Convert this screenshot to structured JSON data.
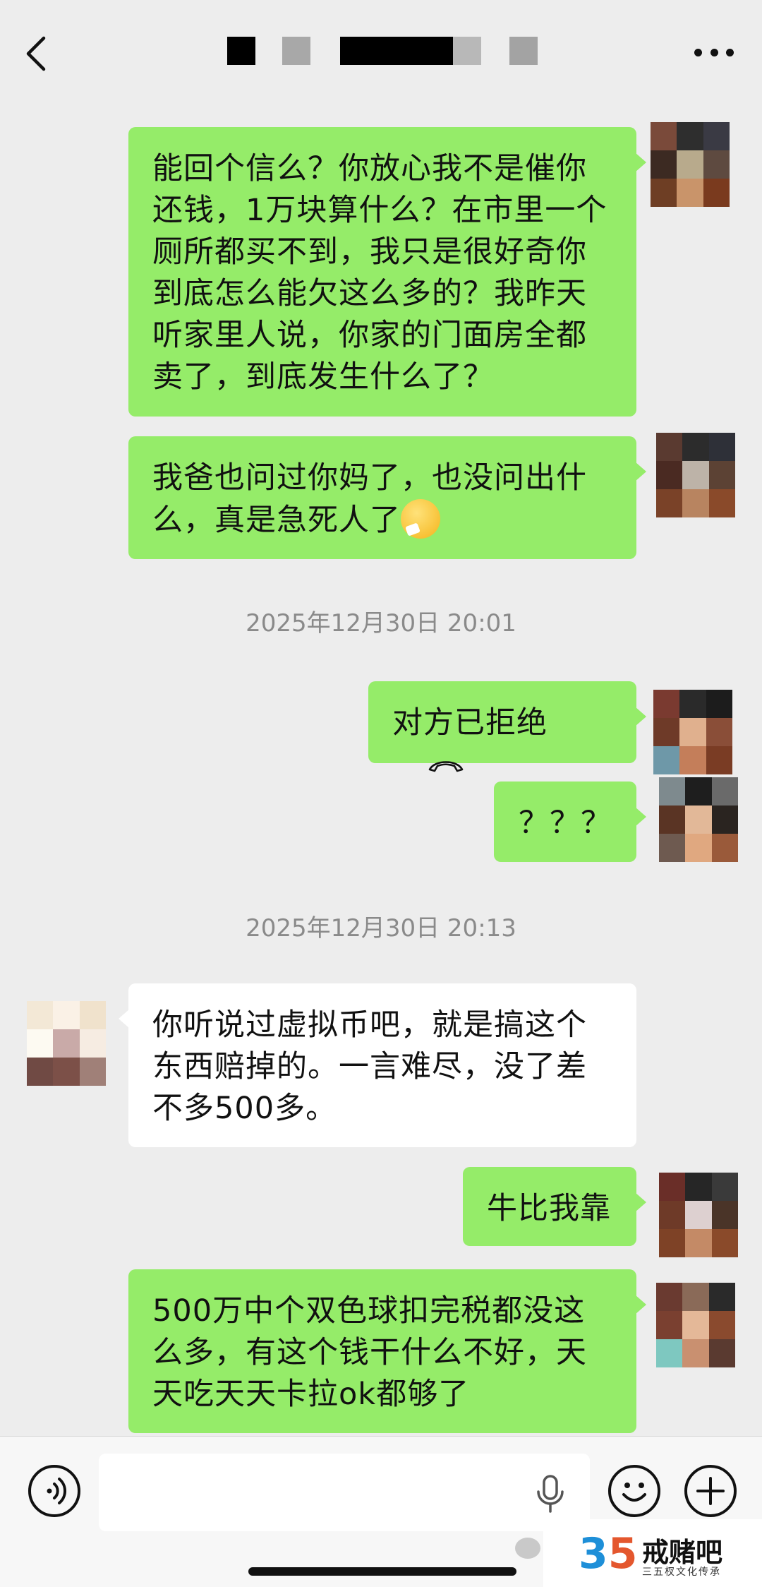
{
  "header": {
    "back_icon": "chevron-left-icon",
    "more_icon": "more-horizontal-icon"
  },
  "messages": [
    {
      "side": "out",
      "text": "能回个信么？你放心我不是催你还钱，1万块算什么？在市里一个厕所都买不到，我只是很好奇你到底怎么能欠这么多的？我昨天听家里人说，你家的门面房全都卖了，到底发生什么了？"
    },
    {
      "side": "out",
      "text": "我爸也问过你妈了，也没问出什么，真是急死人了",
      "emoji": "crying-emoji"
    },
    {
      "timestamp": "2025年12月30日 20:01"
    },
    {
      "side": "out",
      "text": "对方已拒绝",
      "icon": "phone-hangup-icon"
    },
    {
      "side": "out",
      "text": "？？？"
    },
    {
      "timestamp": "2025年12月30日 20:13"
    },
    {
      "side": "in",
      "text": "你听说过虚拟币吧，就是搞这个东西赔掉的。一言难尽，没了差不多500多。"
    },
    {
      "side": "out",
      "text": "牛比我靠"
    },
    {
      "side": "out",
      "text": "500万中个双色球扣完税都没这么多，有这个钱干什么不好，天天吃天天卡拉ok都够了"
    }
  ],
  "inputbar": {
    "voice_icon": "voice-input-icon",
    "mic_icon": "microphone-icon",
    "emoji_icon": "smiley-icon",
    "plus_icon": "plus-icon"
  },
  "watermark": {
    "logo": "35",
    "name": "戒赌吧",
    "subtitle": "三五杈文化传承"
  },
  "colors": {
    "background": "#ededed",
    "outgoing_bubble": "#95ec69",
    "incoming_bubble": "#ffffff",
    "timestamp_text": "#8a8a8a"
  }
}
